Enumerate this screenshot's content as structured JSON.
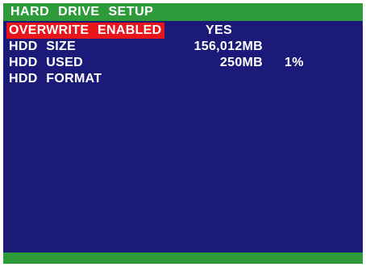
{
  "menu": {
    "title": "HARD  DRIVE  SETUP",
    "overwrite": {
      "label": "OVERWRITE  ENABLED",
      "value": "YES"
    },
    "hdd_size": {
      "label": "HDD  SIZE",
      "value": "156,012MB"
    },
    "hdd_used": {
      "label": "HDD  USED",
      "value": "250MB",
      "percent": "1%"
    },
    "hdd_format": {
      "label": "HDD  FORMAT"
    }
  },
  "colors": {
    "background": "#1c1a78",
    "bar": "#2f9a3a",
    "highlight": "#e8161b",
    "text": "#ffffff"
  }
}
